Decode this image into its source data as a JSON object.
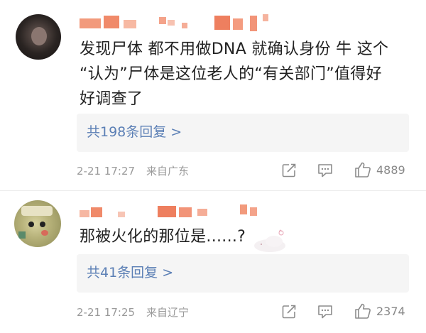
{
  "comments": [
    {
      "text_lines": [
        "发现尸体 都不用做DNA 就确认身份 牛 这个",
        "“认为”尸体是这位老人的“有关部门”值得好",
        "好调查了"
      ],
      "reply_label": "共198条回复 >",
      "time": "2-21 17:27",
      "location": "来自广东",
      "likes": "4889"
    },
    {
      "text_lines": [
        "那被火化的那位是......?"
      ],
      "reply_label": "共41条回复 >",
      "time": "2-21 17:25",
      "location": "来自辽宁",
      "likes": "2374"
    }
  ],
  "icons": {
    "share": "share-icon",
    "comment": "comment-icon",
    "like": "thumbs-up-icon"
  },
  "colors": {
    "link": "#5b7fb5",
    "meta": "#9a9a9a",
    "text": "#222222",
    "mosaic": "#f08a6a"
  }
}
